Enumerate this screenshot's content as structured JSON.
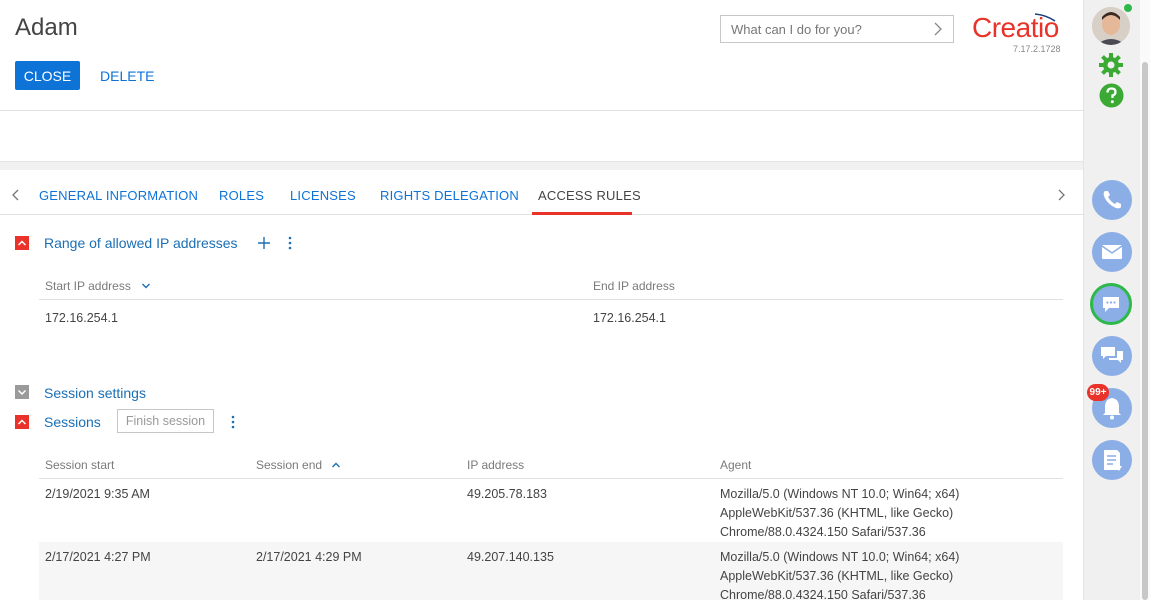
{
  "page": {
    "title": "Adam"
  },
  "toolbar": {
    "close_label": "CLOSE",
    "delete_label": "DELETE"
  },
  "search": {
    "placeholder": "What can I do for you?"
  },
  "brand": {
    "name": "Creatio",
    "version": "7.17.2.1728",
    "color": "#e9332a"
  },
  "tabs": [
    {
      "label": "GENERAL INFORMATION",
      "active": false
    },
    {
      "label": "ROLES",
      "active": false
    },
    {
      "label": "LICENSES",
      "active": false
    },
    {
      "label": "RIGHTS DELEGATION",
      "active": false
    },
    {
      "label": "ACCESS RULES",
      "active": true
    }
  ],
  "ip_ranges": {
    "title": "Range of allowed IP addresses",
    "columns": [
      "Start IP address",
      "End IP address"
    ],
    "rows": [
      [
        "172.16.254.1",
        "172.16.254.1"
      ]
    ]
  },
  "session_settings": {
    "title": "Session settings"
  },
  "sessions": {
    "title": "Sessions",
    "finish_label": "Finish session",
    "columns": [
      "Session start",
      "Session end",
      "IP address",
      "Agent"
    ],
    "rows": [
      {
        "start": "2/19/2021 9:35 AM",
        "end": "",
        "ip": "49.205.78.183",
        "agent": [
          "Mozilla/5.0 (Windows NT 10.0; Win64; x64)",
          "AppleWebKit/537.36 (KHTML, like Gecko)",
          "Chrome/88.0.4324.150 Safari/537.36"
        ]
      },
      {
        "start": "2/17/2021 4:27 PM",
        "end": "2/17/2021 4:29 PM",
        "ip": "49.207.140.135",
        "agent": [
          "Mozilla/5.0 (Windows NT 10.0; Win64; x64)",
          "AppleWebKit/537.36 (KHTML, like Gecko)",
          "Chrome/88.0.4324.150 Safari/537.36"
        ]
      }
    ]
  },
  "notifications": {
    "badge": "99+"
  },
  "colors": {
    "accent": "#0d73d7",
    "side_button": "#8aaee5",
    "online": "#2fb84a",
    "settings": "#3aaa35"
  }
}
